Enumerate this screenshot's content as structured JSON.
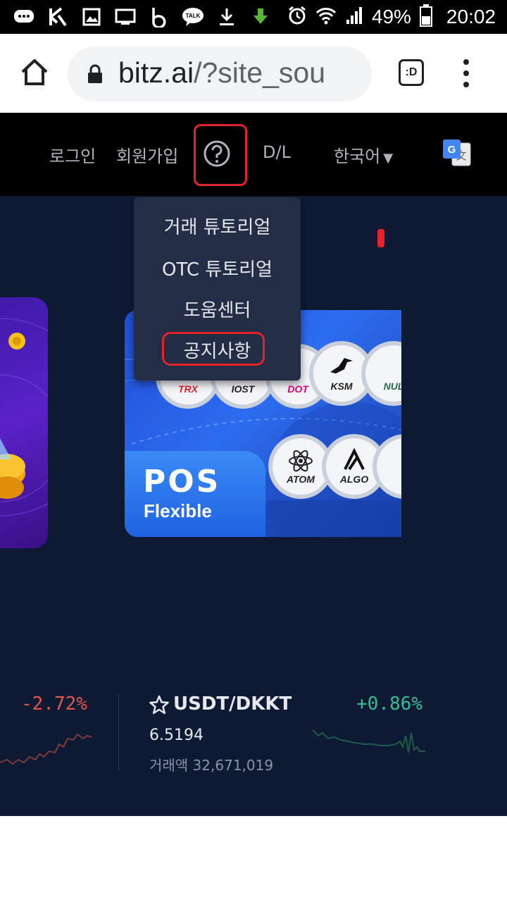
{
  "status_bar": {
    "battery_percent": "49%",
    "time": "20:02",
    "icons": [
      "chat-bubble-icon",
      "k-app-icon",
      "gallery-icon",
      "screen-icon",
      "b-app-icon",
      "talk-icon",
      "download-icon",
      "download-green-icon",
      "alarm-icon",
      "wifi-icon",
      "signal-icon",
      "battery-icon"
    ]
  },
  "browser": {
    "url_host": "bitz.ai",
    "url_path": "/?site_sou",
    "tab_icon_label": ":D"
  },
  "site_header": {
    "login": "로그인",
    "signup": "회원가입",
    "download": "D/L",
    "language": "한국어",
    "language_arrow": "▼"
  },
  "help_menu": {
    "items": [
      {
        "label": "거래 튜토리얼"
      },
      {
        "label": "OTC 튜토리얼"
      },
      {
        "label": "도움센터"
      },
      {
        "label": "공지사항"
      }
    ]
  },
  "banner": {
    "pos_title": "POS",
    "pos_subtitle": "Flexible",
    "coins_top": [
      "TRX",
      "IOST",
      "DOT",
      "KSM",
      "NUL"
    ],
    "coins_bottom": [
      "ATOM",
      "ALGO"
    ]
  },
  "ticker": {
    "left_change": "-2.72%",
    "pair": "USDT/DKKT",
    "price": "6.5194",
    "volume": "거래액 32,671,019",
    "right_change": "+0.86%"
  },
  "colors": {
    "accent_red": "#e3232a",
    "negative": "#e0574b",
    "positive": "#2fbf93",
    "background_dark": "#0e1a33"
  }
}
